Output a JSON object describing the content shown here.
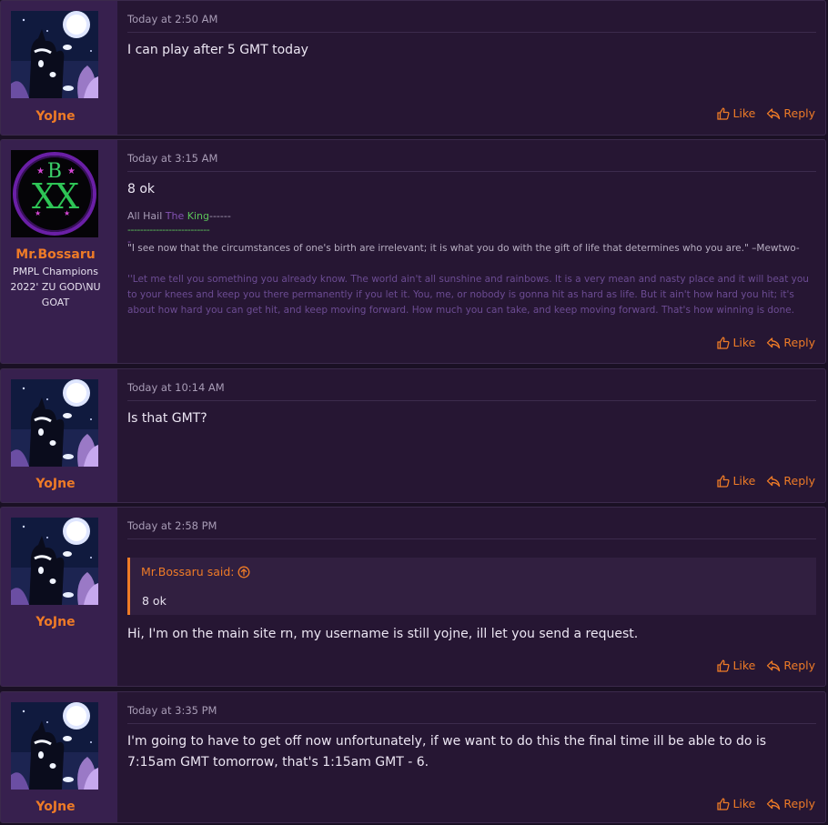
{
  "posts": [
    {
      "username": "YoJne",
      "date": "Today at 2:50 AM",
      "message": "I can play after 5 GMT today",
      "like_label": "Like",
      "reply_label": "Reply"
    },
    {
      "username": "Mr.Bossaru",
      "user_title": "PMPL Champions 2022' ZU GOD\\NU GOAT",
      "date": "Today at 3:15 AM",
      "message": "8 ok",
      "signature": {
        "line_prefix": "All Hail ",
        "line_the": "The",
        "line_king": " King",
        "line_suffix": "------",
        "dashes": "--------------------------",
        "dash_single": "-",
        "quote1": "\"I see now that the circumstances of one's birth are irrelevant; it is what you do with the gift of life that determines who you are.\" –Mewtwo-",
        "quote2": "''Let me tell you something you already know. The world ain't all sunshine and rainbows. It is a very mean and nasty place and it will beat you to your knees and keep you there permanently if you let it. You, me, or nobody is gonna hit as hard as life. But it ain't how hard you hit; it's about how hard you can get hit, and keep moving forward. How much you can take, and keep moving forward. That's how winning is done. Now, if"
      },
      "like_label": "Like",
      "reply_label": "Reply"
    },
    {
      "username": "YoJne",
      "date": "Today at 10:14 AM",
      "message": "Is that GMT?",
      "like_label": "Like",
      "reply_label": "Reply"
    },
    {
      "username": "YoJne",
      "date": "Today at 2:58 PM",
      "quote": {
        "author_said": "Mr.Bossaru said:",
        "text": "8 ok"
      },
      "message": "Hi, I'm on the main site rn, my username is still yojne, ill let you send a request.",
      "like_label": "Like",
      "reply_label": "Reply"
    },
    {
      "username": "YoJne",
      "date": "Today at 3:35 PM",
      "message": "I'm going to have to get off now unfortunately, if we want to do this the final time ill be able to do is 7:15am GMT tomorrow, that's 1:15am GMT - 6.",
      "like_label": "Like",
      "reply_label": "Reply"
    }
  ],
  "colors": {
    "accent": "#ee7b27",
    "post_bg": "#261633",
    "user_panel_bg": "#37204e",
    "signature_purple": "#8453b3",
    "signature_green": "#5cc35a"
  },
  "icons": {
    "like": "thumbs-up-icon",
    "reply": "reply-arrow-icon",
    "quote_jump": "arrow-up-circle-icon"
  }
}
